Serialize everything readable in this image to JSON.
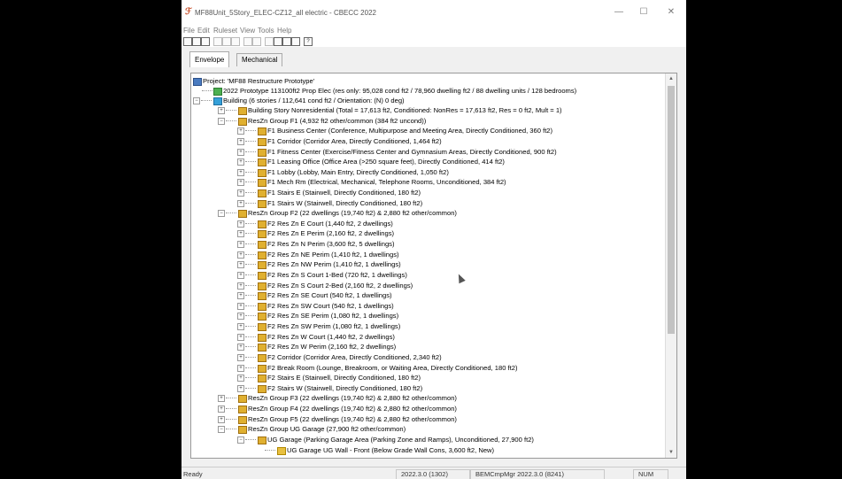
{
  "window": {
    "title": "MF88Unit_5Story_ELEC-CZ12_all electric - CBECC 2022",
    "controls": {
      "minimize": "—",
      "maximize": "☐",
      "close": "✕"
    }
  },
  "menu": [
    "File",
    "Edit",
    "Ruleset",
    "View",
    "Tools",
    "Help"
  ],
  "tabs": {
    "envelope": "Envelope",
    "mechanical": "Mechanical"
  },
  "tree": {
    "project": "Project:  'MF88 Restructure Prototype'",
    "prototype": "2022 Prototype 113100ft2 Prop Elec  (res only: 95,028 cond ft2 / 78,960 dwelling ft2 / 88 dwelling units / 128 bedrooms)",
    "building": "Building  (6 stories / 112,641 cond ft2 / Orientation: (N) 0 deg)",
    "rows": [
      {
        "depth": 1,
        "exp": "+",
        "text": "Building Story Nonresidential  (Total = 17,613 ft2, Conditioned: NonRes = 17,613 ft2, Res = 0 ft2, Mult = 1)"
      },
      {
        "depth": 1,
        "exp": "−",
        "text": "ResZn Group F1  (4,932 ft2 other/common (384 ft2 uncond))"
      },
      {
        "depth": 2,
        "exp": "+",
        "text": "F1 Business Center  (Conference, Multipurpose and Meeting Area, Directly Conditioned, 360 ft2)"
      },
      {
        "depth": 2,
        "exp": "+",
        "text": "F1 Corridor  (Corridor Area, Directly Conditioned, 1,464 ft2)"
      },
      {
        "depth": 2,
        "exp": "+",
        "text": "F1 Fitness Center  (Exercise/Fitness Center and Gymnasium Areas, Directly Conditioned, 900 ft2)"
      },
      {
        "depth": 2,
        "exp": "+",
        "text": "F1 Leasing Office  (Office Area (>250 square feet), Directly Conditioned, 414 ft2)"
      },
      {
        "depth": 2,
        "exp": "+",
        "text": "F1 Lobby  (Lobby, Main Entry, Directly Conditioned, 1,050 ft2)"
      },
      {
        "depth": 2,
        "exp": "+",
        "text": "F1 Mech Rm  (Electrical, Mechanical, Telephone Rooms, Unconditioned, 384 ft2)"
      },
      {
        "depth": 2,
        "exp": "+",
        "text": "F1 Stairs E  (Stairwell, Directly Conditioned, 180 ft2)"
      },
      {
        "depth": 2,
        "exp": "+",
        "text": "F1 Stairs W  (Stairwell, Directly Conditioned, 180 ft2)"
      },
      {
        "depth": 1,
        "exp": "−",
        "text": "ResZn Group F2  (22 dwellings (19,740 ft2) & 2,880 ft2 other/common)"
      },
      {
        "depth": 2,
        "exp": "+",
        "text": "F2 Res Zn E Court  (1,440 ft2, 2 dwellings)"
      },
      {
        "depth": 2,
        "exp": "+",
        "text": "F2 Res Zn E Perim  (2,160 ft2, 2 dwellings)"
      },
      {
        "depth": 2,
        "exp": "+",
        "text": "F2 Res Zn N Perim  (3,600 ft2, 5 dwellings)"
      },
      {
        "depth": 2,
        "exp": "+",
        "text": "F2 Res Zn NE Perim  (1,410 ft2, 1 dwellings)"
      },
      {
        "depth": 2,
        "exp": "+",
        "text": "F2 Res Zn NW Perim  (1,410 ft2, 1 dwellings)"
      },
      {
        "depth": 2,
        "exp": "+",
        "text": "F2 Res Zn S Court 1-Bed  (720 ft2, 1 dwellings)"
      },
      {
        "depth": 2,
        "exp": "+",
        "text": "F2 Res Zn S Court 2-Bed  (2,160 ft2, 2 dwellings)"
      },
      {
        "depth": 2,
        "exp": "+",
        "text": "F2 Res Zn SE Court  (540 ft2, 1 dwellings)"
      },
      {
        "depth": 2,
        "exp": "+",
        "text": "F2 Res Zn SW Court  (540 ft2, 1 dwellings)"
      },
      {
        "depth": 2,
        "exp": "+",
        "text": "F2 Res Zn SE Perim  (1,080 ft2, 1 dwellings)"
      },
      {
        "depth": 2,
        "exp": "+",
        "text": "F2 Res Zn SW Perim  (1,080 ft2, 1 dwellings)"
      },
      {
        "depth": 2,
        "exp": "+",
        "text": "F2 Res Zn W Court  (1,440 ft2, 2 dwellings)"
      },
      {
        "depth": 2,
        "exp": "+",
        "text": "F2 Res Zn W Perim  (2,160 ft2, 2 dwellings)"
      },
      {
        "depth": 2,
        "exp": "+",
        "text": "F2 Corridor  (Corridor Area, Directly Conditioned, 2,340 ft2)"
      },
      {
        "depth": 2,
        "exp": "+",
        "text": "F2 Break Room  (Lounge, Breakroom, or Waiting Area, Directly Conditioned, 180 ft2)"
      },
      {
        "depth": 2,
        "exp": "+",
        "text": "F2 Stairs E  (Stairwell, Directly Conditioned, 180 ft2)"
      },
      {
        "depth": 2,
        "exp": "+",
        "text": "F2 Stairs W  (Stairwell, Directly Conditioned, 180 ft2)"
      },
      {
        "depth": 1,
        "exp": "+",
        "text": "ResZn Group F3  (22 dwellings (19,740 ft2) & 2,880 ft2 other/common)"
      },
      {
        "depth": 1,
        "exp": "+",
        "text": "ResZn Group F4  (22 dwellings (19,740 ft2) & 2,880 ft2 other/common)"
      },
      {
        "depth": 1,
        "exp": "+",
        "text": "ResZn Group F5  (22 dwellings (19,740 ft2) & 2,880 ft2 other/common)"
      },
      {
        "depth": 1,
        "exp": "−",
        "text": "ResZn Group UG Garage  (27,900 ft2 other/common)"
      },
      {
        "depth": 2,
        "exp": "−",
        "text": "UG Garage  (Parking Garage Area (Parking Zone and Ramps), Unconditioned, 27,900 ft2)"
      },
      {
        "depth": 3,
        "exp": "",
        "text": "UG Garage UG Wall - Front  (Below Grade Wall Cons, 3,600 ft2, New)"
      }
    ]
  },
  "status": {
    "ready": "Ready",
    "version": "2022.3.0 (1302)",
    "bemcmp": "BEMCmpMgr 2022.3.0 (8241)",
    "num": "NUM"
  }
}
